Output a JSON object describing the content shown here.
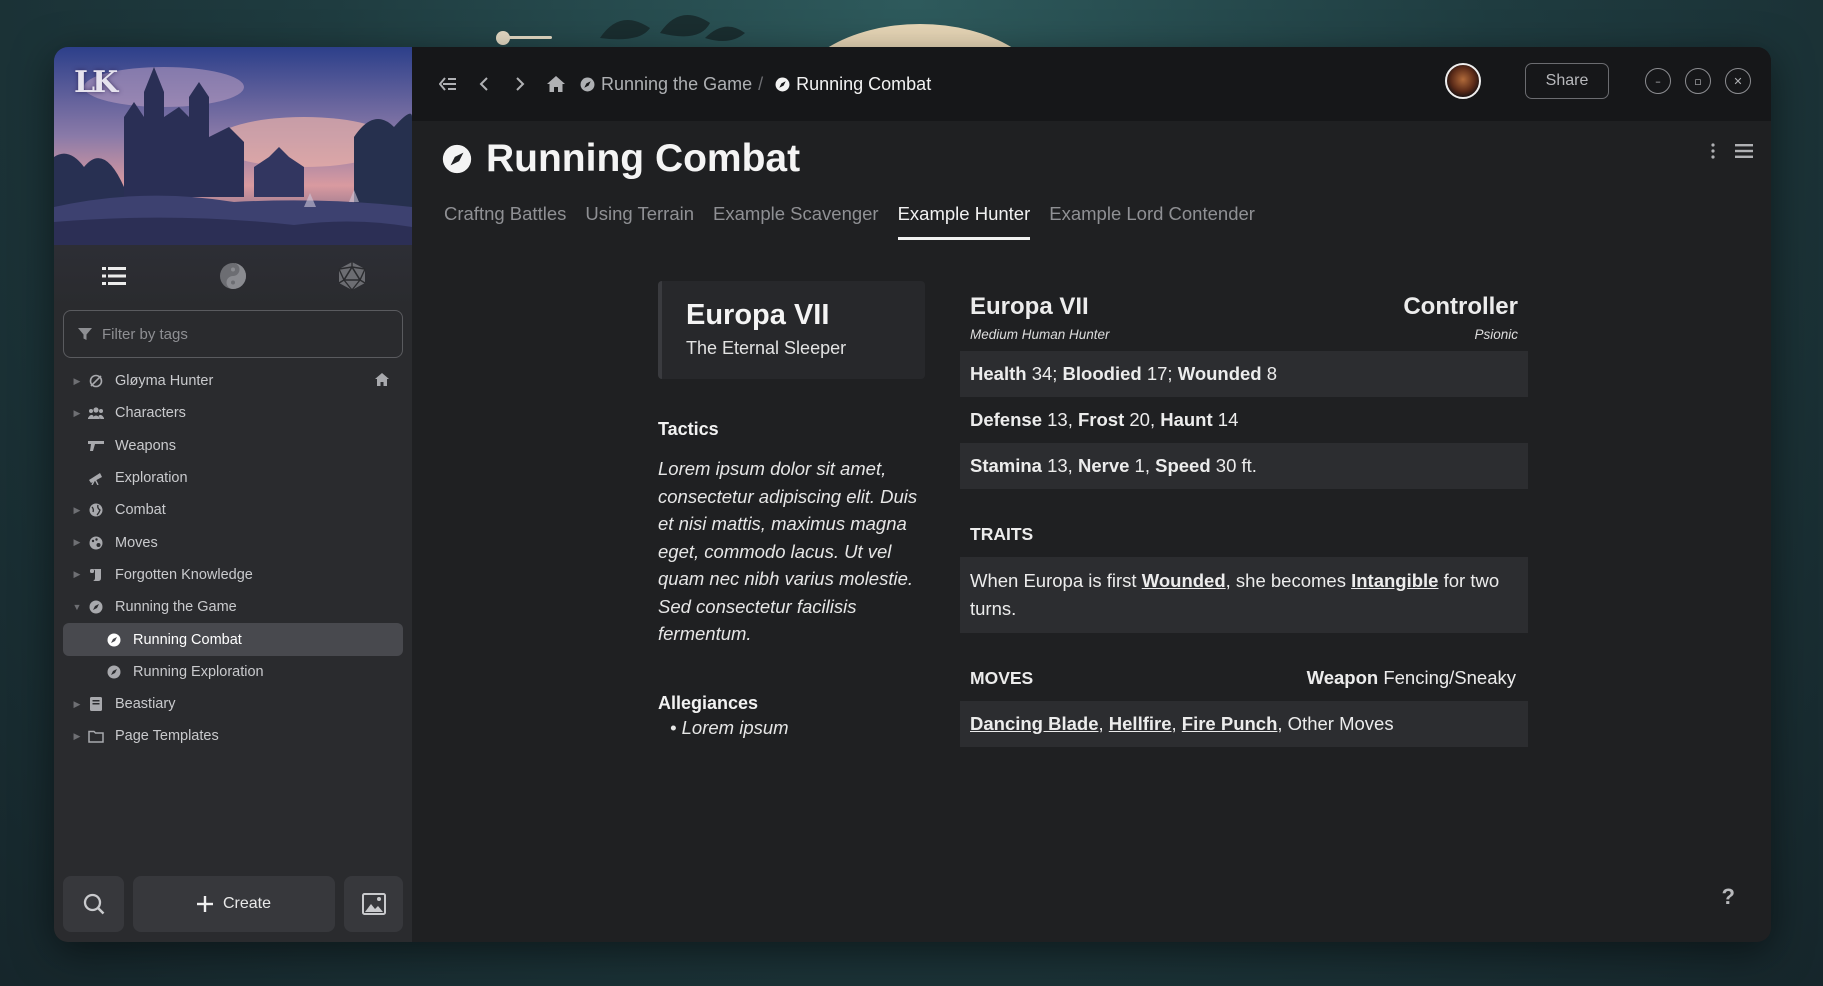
{
  "app": {
    "logo_text": "LK"
  },
  "sidebar": {
    "filter_placeholder": "Filter by tags",
    "items": [
      {
        "label": "Gløyma Hunter",
        "icon": "no-symbol-icon",
        "has_children": true
      },
      {
        "label": "Characters",
        "icon": "users-icon",
        "has_children": true
      },
      {
        "label": "Weapons",
        "icon": "gun-icon",
        "has_children": false
      },
      {
        "label": "Exploration",
        "icon": "telescope-icon",
        "has_children": false
      },
      {
        "label": "Combat",
        "icon": "globe-icon",
        "has_children": true
      },
      {
        "label": "Moves",
        "icon": "palette-icon",
        "has_children": true
      },
      {
        "label": "Forgotten Knowledge",
        "icon": "scroll-icon",
        "has_children": true
      },
      {
        "label": "Running the Game",
        "icon": "compass-icon",
        "has_children": true,
        "expanded": true
      },
      {
        "label": "Running Combat",
        "icon": "compass-icon",
        "child": true,
        "active": true
      },
      {
        "label": "Running Exploration",
        "icon": "compass-icon",
        "child": true
      },
      {
        "label": "Beastiary",
        "icon": "book-icon",
        "has_children": true
      },
      {
        "label": "Page Templates",
        "icon": "folder-icon",
        "has_children": true
      }
    ],
    "create_label": "Create"
  },
  "topbar": {
    "breadcrumb_parent": "Running the Game",
    "breadcrumb_sep": "/",
    "breadcrumb_current": "Running Combat",
    "share_label": "Share"
  },
  "page": {
    "title": "Running Combat",
    "tabs": [
      "Craftng Battles",
      "Using Terrain",
      "Example Scavenger",
      "Example Hunter",
      "Example Lord Contender"
    ],
    "active_tab": "Example Hunter"
  },
  "card": {
    "name": "Europa VII",
    "subtitle": "The Eternal Sleeper",
    "tactics_heading": "Tactics",
    "tactics_text": "Lorem ipsum dolor sit amet, consectetur adipiscing elit. Duis et nisi mattis, maximus magna eget, commodo lacus. Ut vel quam nec nibh varius molestie. Sed consectetur facilisis fermentum.",
    "allegiances_heading": "Allegiances",
    "allegiances": [
      "Lorem ipsum"
    ]
  },
  "statblock": {
    "name": "Europa VII",
    "descriptor": "Medium Human Hunter",
    "role": "Controller",
    "role_sub": "Psionic",
    "health_label": "Health",
    "health": "34;",
    "bloodied_label": "Bloodied",
    "bloodied": "17;",
    "wounded_label": "Wounded",
    "wounded": "8",
    "defense_label": "Defense",
    "defense": "13,",
    "frost_label": "Frost",
    "frost": "20,",
    "haunt_label": "Haunt",
    "haunt": "14",
    "stamina_label": "Stamina",
    "stamina": "13,",
    "nerve_label": "Nerve",
    "nerve": "1,",
    "speed_label": "Speed",
    "speed": "30 ft.",
    "traits_heading": "TRAITS",
    "trait_pre": "When Europa is first",
    "trait_link1": "Wounded",
    "trait_mid": ", she becomes",
    "trait_link2": "Intangible",
    "trait_post": "for two turns.",
    "moves_heading": "MOVES",
    "weapon_label": "Weapon",
    "weapon_value": "Fencing/Sneaky",
    "moves": [
      "Dancing Blade",
      "Hellfire",
      "Fire Punch"
    ],
    "moves_tail": ", Other Moves"
  },
  "help_label": "?",
  "colors": {
    "background": "#1f2022",
    "sidebar": "#2a2b2e",
    "topbar": "#161719",
    "shade": "#2c2d30"
  }
}
